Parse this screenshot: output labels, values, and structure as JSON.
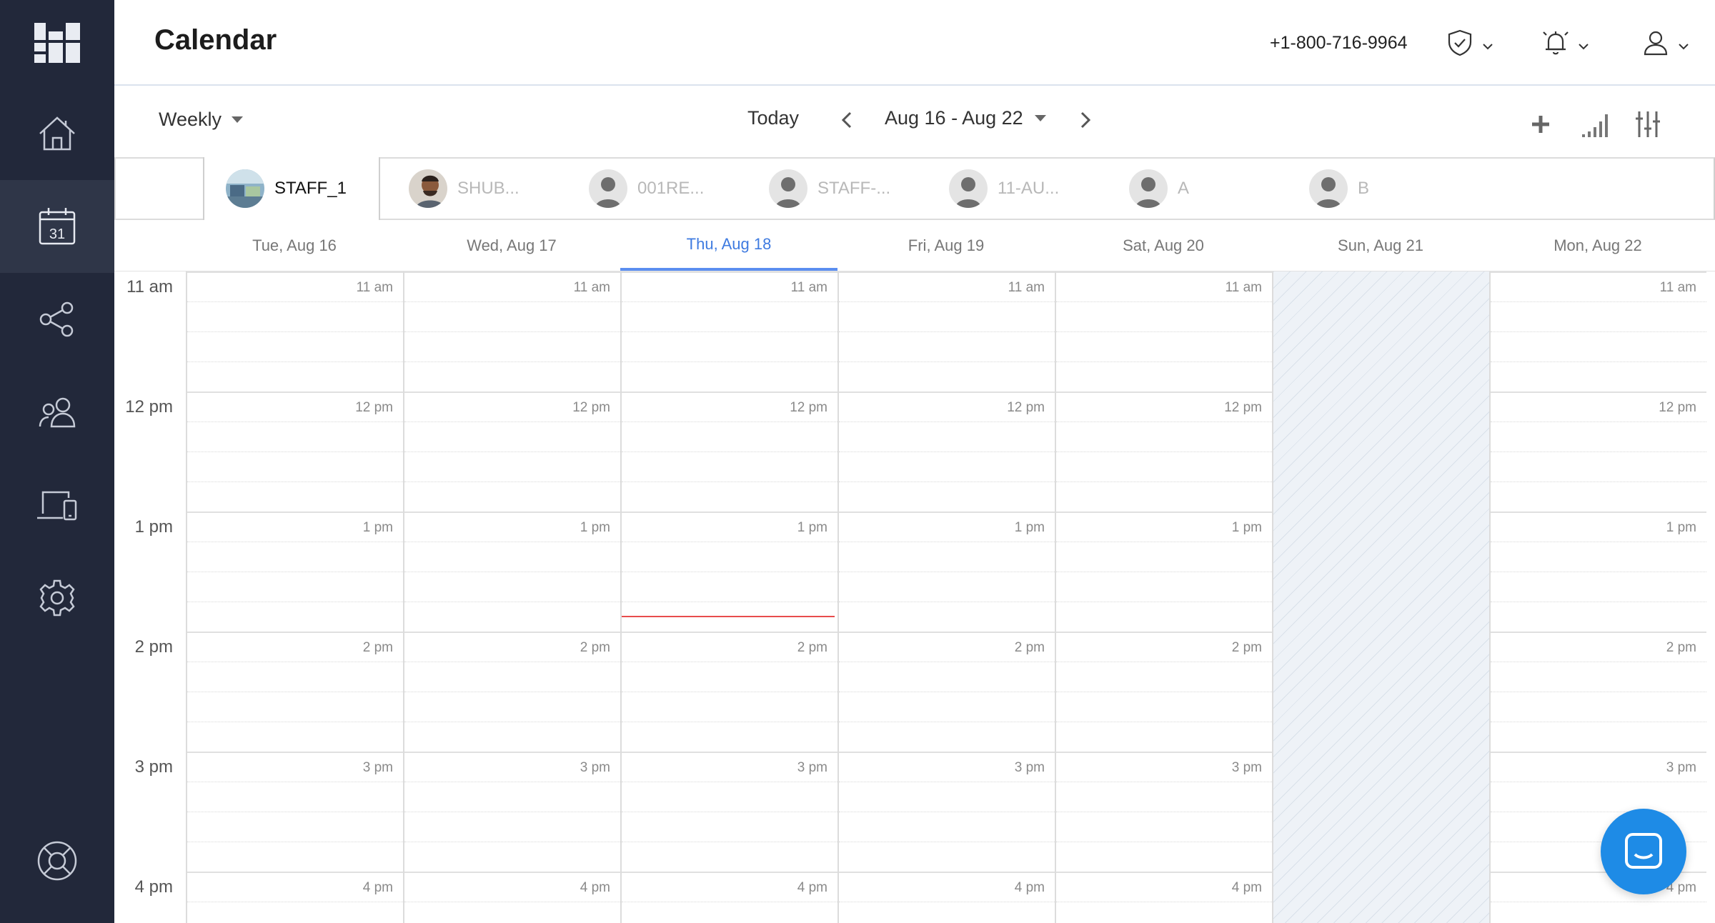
{
  "colors": {
    "sidebar": "#22283a",
    "accent": "#3f7be0",
    "now_line": "#e84c4c",
    "chat": "#1e8be6"
  },
  "sidebar": {
    "items": [
      {
        "name": "home",
        "icon": "home-icon"
      },
      {
        "name": "calendar",
        "icon": "calendar-icon",
        "badge": "31",
        "active": true
      },
      {
        "name": "share",
        "icon": "share-icon"
      },
      {
        "name": "users",
        "icon": "users-icon"
      },
      {
        "name": "devices",
        "icon": "devices-icon"
      },
      {
        "name": "settings",
        "icon": "gear-icon"
      },
      {
        "name": "help",
        "icon": "lifebuoy-icon"
      }
    ]
  },
  "header": {
    "title": "Calendar",
    "phone": "+1-800-716-9964",
    "icons": [
      "shield-icon",
      "bell-icon",
      "user-icon"
    ]
  },
  "toolbar": {
    "view": "Weekly",
    "today": "Today",
    "range": "Aug 16 - Aug 22",
    "icons": [
      "add-icon",
      "signal-icon",
      "filter-icon"
    ]
  },
  "staff": [
    {
      "name": "STAFF_1",
      "active": true,
      "photo": true
    },
    {
      "name": "SHUB...",
      "active": false,
      "photo": true
    },
    {
      "name": "001RE...",
      "active": false
    },
    {
      "name": "STAFF-...",
      "active": false
    },
    {
      "name": "11-AU...",
      "active": false
    },
    {
      "name": "A",
      "active": false
    },
    {
      "name": "B",
      "active": false
    }
  ],
  "days": [
    {
      "label": "Tue, Aug 16"
    },
    {
      "label": "Wed, Aug 17"
    },
    {
      "label": "Thu, Aug 18",
      "today": true
    },
    {
      "label": "Fri, Aug 19"
    },
    {
      "label": "Sat, Aug 20"
    },
    {
      "label": "Sun, Aug 21",
      "off": true
    },
    {
      "label": "Mon, Aug 22"
    }
  ],
  "hours": [
    "11 am",
    "12 pm",
    "1 pm",
    "2 pm",
    "3 pm",
    "4 pm"
  ],
  "now_marker": {
    "day": "Thu, Aug 18",
    "time_fraction_of_hour_after_1pm": 0.87
  }
}
